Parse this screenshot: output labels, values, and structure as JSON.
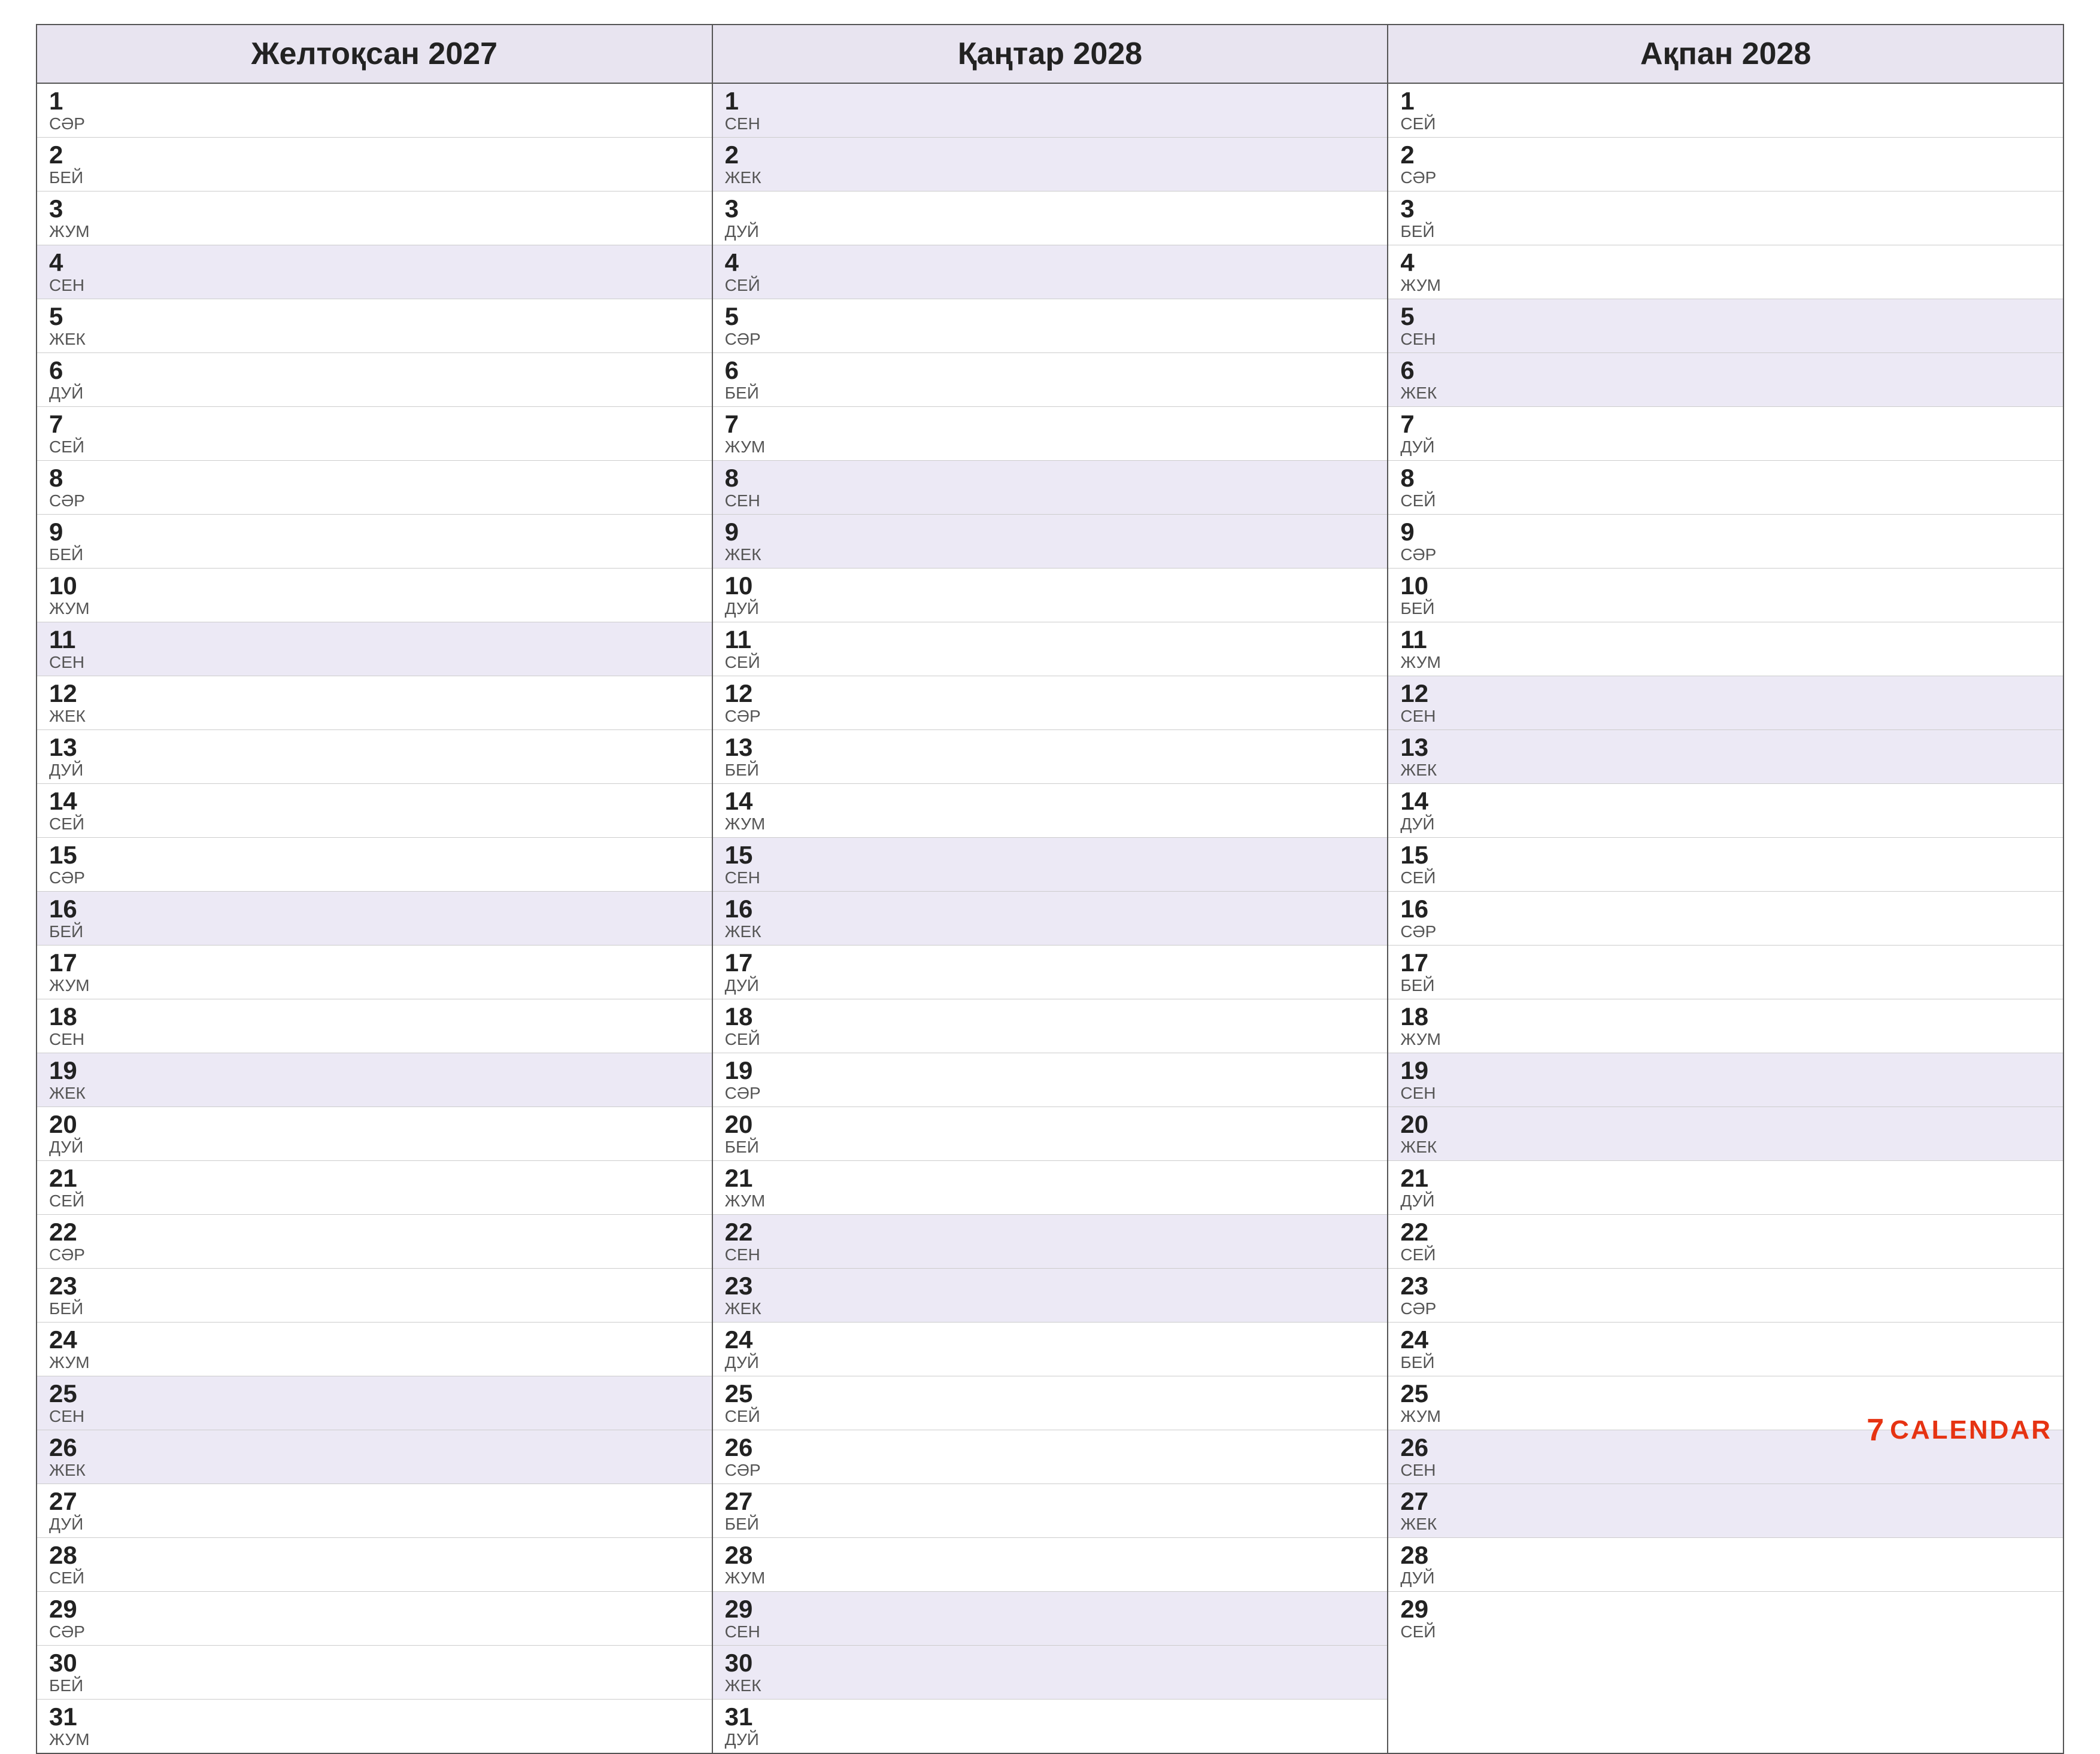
{
  "months": [
    {
      "title": "Желтоқсан 2027",
      "days": [
        {
          "num": "1",
          "name": "СәР",
          "highlighted": false
        },
        {
          "num": "2",
          "name": "БЕЙ",
          "highlighted": false
        },
        {
          "num": "3",
          "name": "ЖУМ",
          "highlighted": false
        },
        {
          "num": "4",
          "name": "СЕН",
          "highlighted": true
        },
        {
          "num": "5",
          "name": "ЖЕК",
          "highlighted": false
        },
        {
          "num": "6",
          "name": "ДУЙ",
          "highlighted": false
        },
        {
          "num": "7",
          "name": "СЕЙ",
          "highlighted": false
        },
        {
          "num": "8",
          "name": "СәР",
          "highlighted": false
        },
        {
          "num": "9",
          "name": "БЕЙ",
          "highlighted": false
        },
        {
          "num": "10",
          "name": "ЖУМ",
          "highlighted": false
        },
        {
          "num": "11",
          "name": "СЕН",
          "highlighted": true
        },
        {
          "num": "12",
          "name": "ЖЕК",
          "highlighted": false
        },
        {
          "num": "13",
          "name": "ДУЙ",
          "highlighted": false
        },
        {
          "num": "14",
          "name": "СЕЙ",
          "highlighted": false
        },
        {
          "num": "15",
          "name": "СәР",
          "highlighted": false
        },
        {
          "num": "16",
          "name": "БЕЙ",
          "highlighted": true
        },
        {
          "num": "17",
          "name": "ЖУМ",
          "highlighted": false
        },
        {
          "num": "18",
          "name": "СЕН",
          "highlighted": false
        },
        {
          "num": "19",
          "name": "ЖЕК",
          "highlighted": true
        },
        {
          "num": "20",
          "name": "ДУЙ",
          "highlighted": false
        },
        {
          "num": "21",
          "name": "СЕЙ",
          "highlighted": false
        },
        {
          "num": "22",
          "name": "СәР",
          "highlighted": false
        },
        {
          "num": "23",
          "name": "БЕЙ",
          "highlighted": false
        },
        {
          "num": "24",
          "name": "ЖУМ",
          "highlighted": false
        },
        {
          "num": "25",
          "name": "СЕН",
          "highlighted": true
        },
        {
          "num": "26",
          "name": "ЖЕК",
          "highlighted": true
        },
        {
          "num": "27",
          "name": "ДУЙ",
          "highlighted": false
        },
        {
          "num": "28",
          "name": "СЕЙ",
          "highlighted": false
        },
        {
          "num": "29",
          "name": "СәР",
          "highlighted": false
        },
        {
          "num": "30",
          "name": "БЕЙ",
          "highlighted": false
        },
        {
          "num": "31",
          "name": "ЖУМ",
          "highlighted": false
        }
      ]
    },
    {
      "title": "Қаңтар 2028",
      "days": [
        {
          "num": "1",
          "name": "СЕН",
          "highlighted": true
        },
        {
          "num": "2",
          "name": "ЖЕК",
          "highlighted": true
        },
        {
          "num": "3",
          "name": "ДУЙ",
          "highlighted": false
        },
        {
          "num": "4",
          "name": "СЕЙ",
          "highlighted": true
        },
        {
          "num": "5",
          "name": "СәР",
          "highlighted": false
        },
        {
          "num": "6",
          "name": "БЕЙ",
          "highlighted": false
        },
        {
          "num": "7",
          "name": "ЖУМ",
          "highlighted": false
        },
        {
          "num": "8",
          "name": "СЕН",
          "highlighted": true
        },
        {
          "num": "9",
          "name": "ЖЕК",
          "highlighted": true
        },
        {
          "num": "10",
          "name": "ДУЙ",
          "highlighted": false
        },
        {
          "num": "11",
          "name": "СЕЙ",
          "highlighted": false
        },
        {
          "num": "12",
          "name": "СәР",
          "highlighted": false
        },
        {
          "num": "13",
          "name": "БЕЙ",
          "highlighted": false
        },
        {
          "num": "14",
          "name": "ЖУМ",
          "highlighted": false
        },
        {
          "num": "15",
          "name": "СЕН",
          "highlighted": true
        },
        {
          "num": "16",
          "name": "ЖЕК",
          "highlighted": true
        },
        {
          "num": "17",
          "name": "ДУЙ",
          "highlighted": false
        },
        {
          "num": "18",
          "name": "СЕЙ",
          "highlighted": false
        },
        {
          "num": "19",
          "name": "СәР",
          "highlighted": false
        },
        {
          "num": "20",
          "name": "БЕЙ",
          "highlighted": false
        },
        {
          "num": "21",
          "name": "ЖУМ",
          "highlighted": false
        },
        {
          "num": "22",
          "name": "СЕН",
          "highlighted": true
        },
        {
          "num": "23",
          "name": "ЖЕК",
          "highlighted": true
        },
        {
          "num": "24",
          "name": "ДУЙ",
          "highlighted": false
        },
        {
          "num": "25",
          "name": "СЕЙ",
          "highlighted": false
        },
        {
          "num": "26",
          "name": "СәР",
          "highlighted": false
        },
        {
          "num": "27",
          "name": "БЕЙ",
          "highlighted": false
        },
        {
          "num": "28",
          "name": "ЖУМ",
          "highlighted": false
        },
        {
          "num": "29",
          "name": "СЕН",
          "highlighted": true
        },
        {
          "num": "30",
          "name": "ЖЕК",
          "highlighted": true
        },
        {
          "num": "31",
          "name": "ДУЙ",
          "highlighted": false
        }
      ]
    },
    {
      "title": "Ақпан 2028",
      "days": [
        {
          "num": "1",
          "name": "СЕЙ",
          "highlighted": false
        },
        {
          "num": "2",
          "name": "СәР",
          "highlighted": false
        },
        {
          "num": "3",
          "name": "БЕЙ",
          "highlighted": false
        },
        {
          "num": "4",
          "name": "ЖУМ",
          "highlighted": false
        },
        {
          "num": "5",
          "name": "СЕН",
          "highlighted": true
        },
        {
          "num": "6",
          "name": "ЖЕК",
          "highlighted": true
        },
        {
          "num": "7",
          "name": "ДУЙ",
          "highlighted": false
        },
        {
          "num": "8",
          "name": "СЕЙ",
          "highlighted": false
        },
        {
          "num": "9",
          "name": "СәР",
          "highlighted": false
        },
        {
          "num": "10",
          "name": "БЕЙ",
          "highlighted": false
        },
        {
          "num": "11",
          "name": "ЖУМ",
          "highlighted": false
        },
        {
          "num": "12",
          "name": "СЕН",
          "highlighted": true
        },
        {
          "num": "13",
          "name": "ЖЕК",
          "highlighted": true
        },
        {
          "num": "14",
          "name": "ДУЙ",
          "highlighted": false
        },
        {
          "num": "15",
          "name": "СЕЙ",
          "highlighted": false
        },
        {
          "num": "16",
          "name": "СәР",
          "highlighted": false
        },
        {
          "num": "17",
          "name": "БЕЙ",
          "highlighted": false
        },
        {
          "num": "18",
          "name": "ЖУМ",
          "highlighted": false
        },
        {
          "num": "19",
          "name": "СЕН",
          "highlighted": true
        },
        {
          "num": "20",
          "name": "ЖЕК",
          "highlighted": true
        },
        {
          "num": "21",
          "name": "ДУЙ",
          "highlighted": false
        },
        {
          "num": "22",
          "name": "СЕЙ",
          "highlighted": false
        },
        {
          "num": "23",
          "name": "СәР",
          "highlighted": false
        },
        {
          "num": "24",
          "name": "БЕЙ",
          "highlighted": false
        },
        {
          "num": "25",
          "name": "ЖУМ",
          "highlighted": false
        },
        {
          "num": "26",
          "name": "СЕН",
          "highlighted": true
        },
        {
          "num": "27",
          "name": "ЖЕК",
          "highlighted": true
        },
        {
          "num": "28",
          "name": "ДУЙ",
          "highlighted": false
        },
        {
          "num": "29",
          "name": "СЕЙ",
          "highlighted": false
        }
      ]
    }
  ],
  "logo": {
    "number": "7",
    "text": "CALENDAR"
  }
}
